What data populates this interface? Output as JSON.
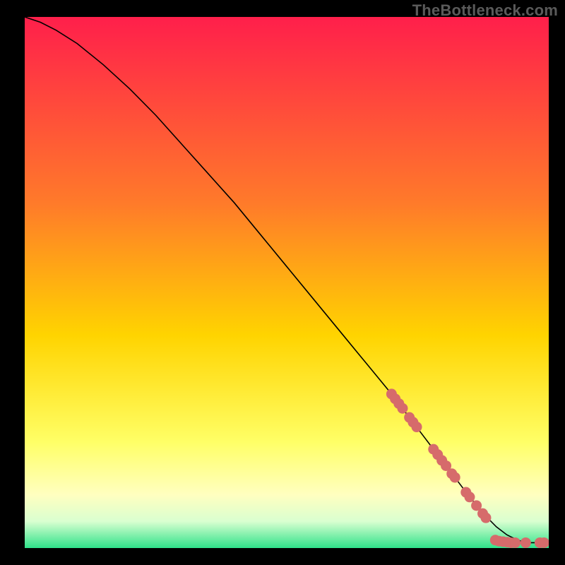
{
  "watermark": "TheBottleneck.com",
  "colors": {
    "gradient_top": "#ff1f4b",
    "gradient_mid1": "#ff7a2a",
    "gradient_mid2": "#ffd400",
    "gradient_mid3": "#ffff66",
    "gradient_mid4": "#ffffc0",
    "gradient_mid5": "#d9ffd0",
    "gradient_bottom": "#2fe28a",
    "curve": "#000000",
    "marker": "#d66b6b",
    "frame": "#000000"
  },
  "chart_data": {
    "type": "line",
    "title": "",
    "xlabel": "",
    "ylabel": "",
    "xlim": [
      0,
      100
    ],
    "ylim": [
      0,
      100
    ],
    "grid": false,
    "curve": {
      "name": "bottleneck-curve",
      "x": [
        0,
        3,
        6,
        10,
        15,
        20,
        25,
        30,
        35,
        40,
        45,
        50,
        55,
        60,
        65,
        70,
        75,
        80,
        85,
        88,
        90,
        92,
        94,
        96,
        98,
        100
      ],
      "y": [
        100,
        99,
        97.5,
        95,
        91,
        86.5,
        81.5,
        76,
        70.5,
        65,
        59,
        53,
        47,
        41,
        35,
        29,
        22.5,
        16,
        9.5,
        6,
        4,
        2.5,
        1.5,
        1,
        1,
        1
      ]
    },
    "markers": {
      "name": "highlighted-points",
      "points": [
        {
          "x": 70.0,
          "y": 29.0
        },
        {
          "x": 70.7,
          "y": 28.1
        },
        {
          "x": 71.4,
          "y": 27.2
        },
        {
          "x": 72.1,
          "y": 26.3
        },
        {
          "x": 73.4,
          "y": 24.6
        },
        {
          "x": 74.1,
          "y": 23.7
        },
        {
          "x": 74.8,
          "y": 22.8
        },
        {
          "x": 78.0,
          "y": 18.6
        },
        {
          "x": 78.8,
          "y": 17.6
        },
        {
          "x": 79.6,
          "y": 16.5
        },
        {
          "x": 80.4,
          "y": 15.5
        },
        {
          "x": 81.5,
          "y": 14.0
        },
        {
          "x": 82.1,
          "y": 13.3
        },
        {
          "x": 84.2,
          "y": 10.5
        },
        {
          "x": 84.9,
          "y": 9.6
        },
        {
          "x": 86.2,
          "y": 8.0
        },
        {
          "x": 87.4,
          "y": 6.5
        },
        {
          "x": 88.0,
          "y": 5.7
        },
        {
          "x": 89.8,
          "y": 1.5
        },
        {
          "x": 90.5,
          "y": 1.3
        },
        {
          "x": 91.3,
          "y": 1.2
        },
        {
          "x": 92.1,
          "y": 1.1
        },
        {
          "x": 92.8,
          "y": 1.0
        },
        {
          "x": 93.6,
          "y": 1.0
        },
        {
          "x": 95.6,
          "y": 1.0
        },
        {
          "x": 98.3,
          "y": 1.0
        },
        {
          "x": 99.1,
          "y": 1.0
        }
      ]
    }
  }
}
